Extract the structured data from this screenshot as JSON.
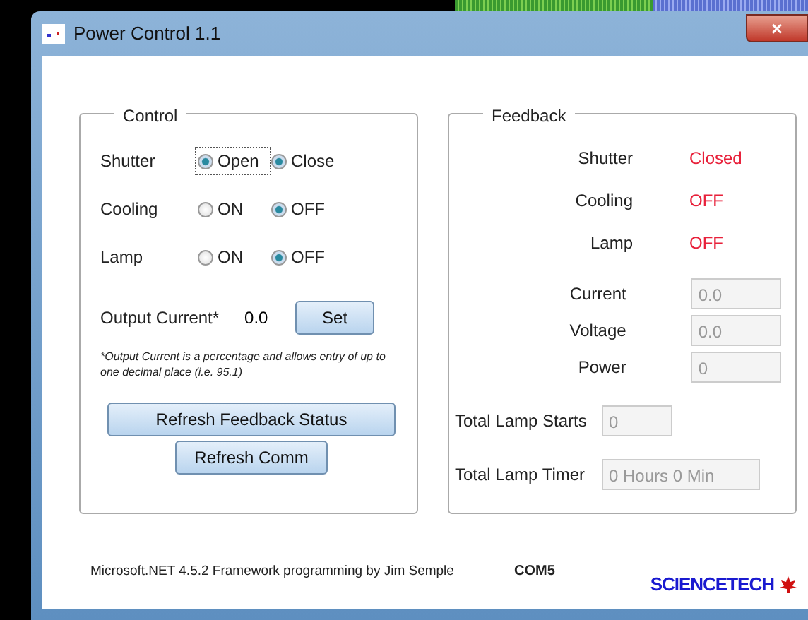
{
  "window": {
    "title": "Power Control 1.1",
    "close": "×"
  },
  "control": {
    "title": "Control",
    "rows": [
      {
        "label": "Shutter",
        "options": [
          {
            "label": "Open",
            "selected": true,
            "focused": true
          },
          {
            "label": "Close",
            "selected": true,
            "focused": false
          }
        ]
      },
      {
        "label": "Cooling",
        "options": [
          {
            "label": "ON",
            "selected": false,
            "focused": false
          },
          {
            "label": "OFF",
            "selected": true,
            "focused": false
          }
        ]
      },
      {
        "label": "Lamp",
        "options": [
          {
            "label": "ON",
            "selected": false,
            "focused": false
          },
          {
            "label": "OFF",
            "selected": true,
            "focused": false
          }
        ]
      }
    ],
    "output_current": {
      "label": "Output Current*",
      "value": "0.0",
      "button": "Set"
    },
    "note": "*Output Current is a percentage and allows entry of up to one decimal place (i.e. 95.1)",
    "buttons": [
      "Refresh Feedback Status",
      "Refresh Comm"
    ]
  },
  "feedback": {
    "title": "Feedback",
    "status": [
      {
        "label": "Shutter",
        "value": "Closed"
      },
      {
        "label": "Cooling",
        "value": "OFF"
      },
      {
        "label": "Lamp",
        "value": "OFF"
      }
    ],
    "readings": [
      {
        "label": "Current",
        "value": "0.0",
        "disabled": true
      },
      {
        "label": "Voltage",
        "value": "0.0",
        "disabled": true
      },
      {
        "label": "Power",
        "value": "0",
        "disabled": true
      }
    ],
    "totals": [
      {
        "label": "Total Lamp Starts",
        "value": "0",
        "disabled": true
      },
      {
        "label": "Total Lamp Timer",
        "value": "0 Hours 0 Min",
        "disabled": true
      }
    ]
  },
  "footer": {
    "credit": "Microsoft.NET 4.5.2 Framework programming by Jim Semple",
    "port": "COM5",
    "logo": "SCIENCETECH"
  }
}
